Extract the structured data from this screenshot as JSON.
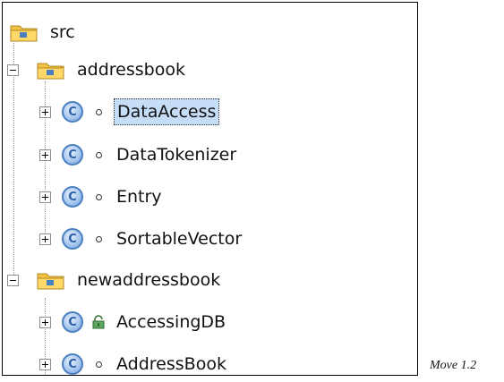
{
  "tree": {
    "root": {
      "label": "src",
      "icon": "package-folder-icon"
    },
    "packages": [
      {
        "label": "addressbook",
        "expanded": true,
        "classes": [
          {
            "label": "DataAccess",
            "visibility": "default",
            "selected": true
          },
          {
            "label": "DataTokenizer",
            "visibility": "default",
            "selected": false
          },
          {
            "label": "Entry",
            "visibility": "default",
            "selected": false
          },
          {
            "label": "SortableVector",
            "visibility": "default",
            "selected": false
          }
        ]
      },
      {
        "label": "newaddressbook",
        "expanded": true,
        "classes": [
          {
            "label": "AccessingDB",
            "visibility": "public",
            "selected": false
          },
          {
            "label": "AddressBook",
            "visibility": "default",
            "selected": false
          }
        ]
      }
    ],
    "class_icon_letter": "C"
  },
  "caption": "Move 1.2",
  "colors": {
    "selection": "#c6ddf7",
    "class_icon": "#4a7fc0",
    "folder": "#f3c244"
  }
}
